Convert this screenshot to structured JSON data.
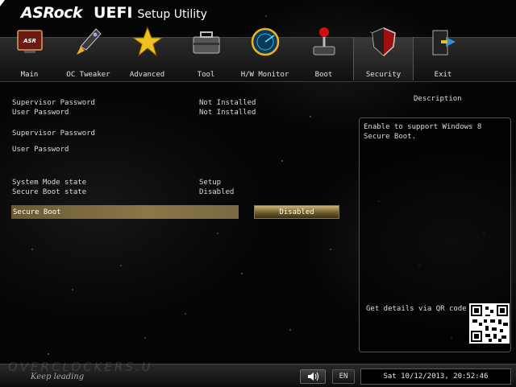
{
  "brand": {
    "logo": "ASRock",
    "uefi": "UEFI",
    "setup": "Setup Utility"
  },
  "nav": {
    "active": "Security",
    "items": [
      {
        "label": "Main",
        "icon": "main-screen-icon"
      },
      {
        "label": "OC Tweaker",
        "icon": "rocket-icon"
      },
      {
        "label": "Advanced",
        "icon": "star-icon"
      },
      {
        "label": "Tool",
        "icon": "toolbox-icon"
      },
      {
        "label": "H/W Monitor",
        "icon": "radar-icon"
      },
      {
        "label": "Boot",
        "icon": "joystick-icon"
      },
      {
        "label": "Security",
        "icon": "shield-icon"
      },
      {
        "label": "Exit",
        "icon": "exit-door-icon"
      }
    ]
  },
  "settings": {
    "supervisor_password_label": "Supervisor Password",
    "supervisor_password_value": "Not Installed",
    "user_password_label": "User Password",
    "user_password_value": "Not Installed",
    "set_supervisor_password": "Supervisor Password",
    "set_user_password": "User Password",
    "system_mode_label": "System Mode state",
    "system_mode_value": "Setup",
    "secure_boot_state_label": "Secure Boot state",
    "secure_boot_state_value": "Disabled",
    "secure_boot_label": "Secure Boot",
    "secure_boot_value": "Disabled"
  },
  "description": {
    "title": "Description",
    "text": "Enable to support Windows 8 Secure Boot.",
    "qr_label": "Get details via QR code"
  },
  "footer": {
    "watermark": "OVERCLOCKERS.U",
    "tagline": "Keep leading",
    "language": "EN",
    "datetime": "Sat 10/12/2013, 20:52:46"
  },
  "colors": {
    "accent_gold": "#8a7648",
    "background": "#050505"
  }
}
